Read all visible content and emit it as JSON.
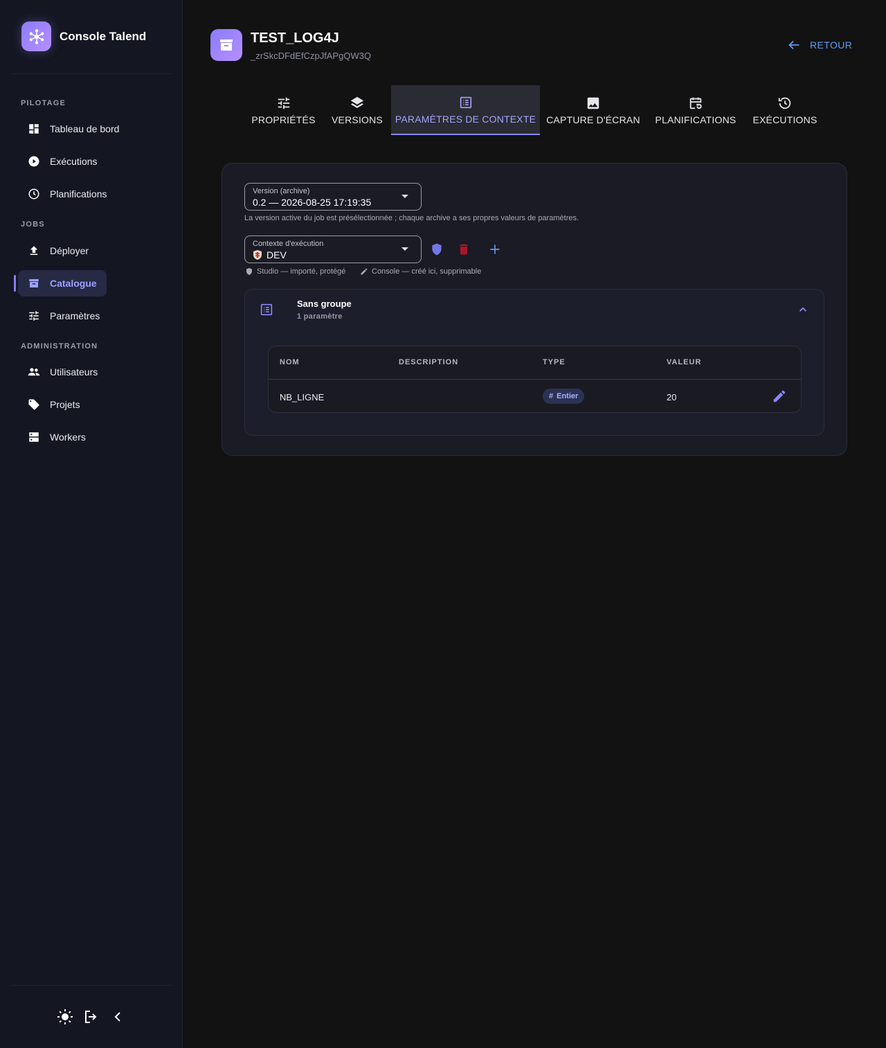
{
  "brand": {
    "name": "Console Talend",
    "icon": "hub-icon"
  },
  "sidebar": {
    "sections": [
      {
        "title": "PILOTAGE"
      },
      {
        "title": "JOBS"
      },
      {
        "title": "ADMINISTRATION"
      }
    ],
    "items": [
      {
        "label": "Tableau de bord",
        "icon": "dashboard-icon"
      },
      {
        "label": "Exécutions",
        "icon": "play-circle-icon"
      },
      {
        "label": "Planifications",
        "icon": "clock-icon"
      },
      {
        "label": "Déployer",
        "icon": "upload-icon"
      },
      {
        "label": "Catalogue",
        "icon": "archive-icon",
        "active": true
      },
      {
        "label": "Paramètres",
        "icon": "tune-icon"
      },
      {
        "label": "Utilisateurs",
        "icon": "people-icon"
      },
      {
        "label": "Projets",
        "icon": "tag-icon"
      },
      {
        "label": "Workers",
        "icon": "server-icon"
      }
    ],
    "footer": [
      "sun-icon",
      "logout-icon",
      "chevron-left-icon"
    ]
  },
  "job": {
    "title": "TEST_LOG4J",
    "id": "_zrSkcDFdEfCzpJfAPgQW3Q"
  },
  "header": {
    "back_label": "RETOUR"
  },
  "tabs": [
    {
      "label": "PROPRIÉTÉS",
      "icon": "tune-icon"
    },
    {
      "label": "VERSIONS",
      "icon": "layers-icon"
    },
    {
      "label": "PARAMÈTRES DE CONTEXTE",
      "icon": "list-alt-icon",
      "active": true
    },
    {
      "label": "CAPTURE D'ÉCRAN",
      "icon": "image-icon"
    },
    {
      "label": "PLANIFICATIONS",
      "icon": "calendar-refresh-icon"
    },
    {
      "label": "EXÉCUTIONS",
      "icon": "history-icon"
    }
  ],
  "version_select": {
    "label": "Version (archive)",
    "value": "0.2 — 2026-08-25 17:19:35",
    "helper": "La version active du job est présélectionnée ; chaque archive a ses propres valeurs de paramètres."
  },
  "context_select": {
    "label": "Contexte d'exécution",
    "value": "DEV",
    "legend_studio": "Studio — importé, protégé",
    "legend_console": "Console — créé ici, supprimable"
  },
  "group": {
    "title": "Sans groupe",
    "count": "1 paramètre",
    "table": {
      "columns": [
        "NOM",
        "DESCRIPTION",
        "TYPE",
        "VALEUR"
      ],
      "rows": [
        {
          "name": "NB_LIGNE",
          "description": "",
          "type": "Entier",
          "value": "20"
        }
      ]
    }
  },
  "colors": {
    "accent": "#8a7bff",
    "link": "#5d9cf5",
    "delete": "#b0142a",
    "shield": "#7178e6"
  }
}
